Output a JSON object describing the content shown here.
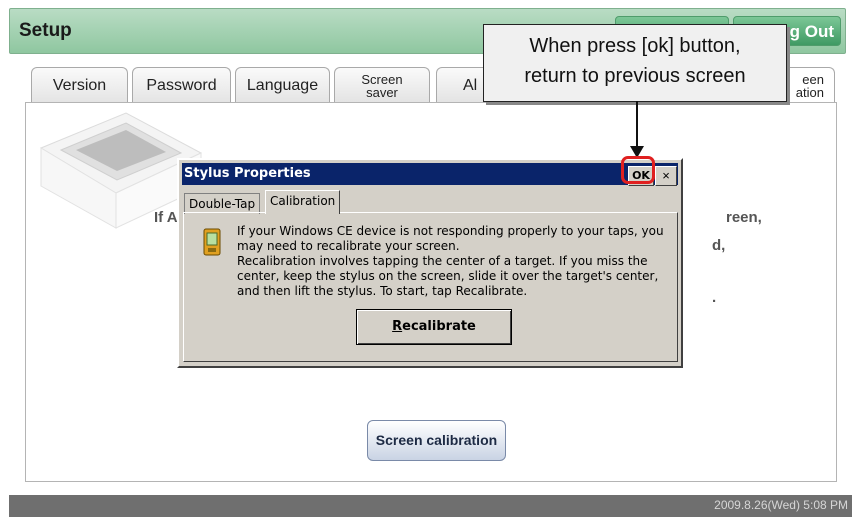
{
  "header": {
    "title": "Setup",
    "btn_logout": "g Out"
  },
  "tabs": [
    {
      "label": "Version"
    },
    {
      "label": "Password"
    },
    {
      "label": "Language"
    },
    {
      "label_line1": "Screen",
      "label_line2": "saver"
    },
    {
      "label": "Al"
    },
    {
      "label_line1": "een",
      "label_line2": "ation"
    }
  ],
  "panel": {
    "text1": "If A",
    "text2": "reen,",
    "text3": "d,",
    "text4": ".",
    "screen_calibration_button": "Screen calibration"
  },
  "dialog": {
    "title": "Stylus Properties",
    "ok_label": "OK",
    "close_label": "×",
    "tab_double_tap": "Double-Tap",
    "tab_calibration": "Calibration",
    "para1": "If your Windows CE device is not responding properly to your taps, you may need to recalibrate your screen.",
    "para2": "Recalibration involves tapping the center of a target. If you miss the center, keep the stylus on the screen, slide it over the target's center, and then lift the stylus. To start, tap Recalibrate.",
    "recal_underlined": "R",
    "recal_rest": "ecalibrate"
  },
  "callout": {
    "line1": "When press [ok] button,",
    "line2": "return to previous screen"
  },
  "status": {
    "datetime": "2009.8.26(Wed)  5:08 PM"
  },
  "colors": {
    "header_green": "#8fc7a0",
    "dialog_titlebar": "#0a246a",
    "highlight_red": "#e02020"
  }
}
